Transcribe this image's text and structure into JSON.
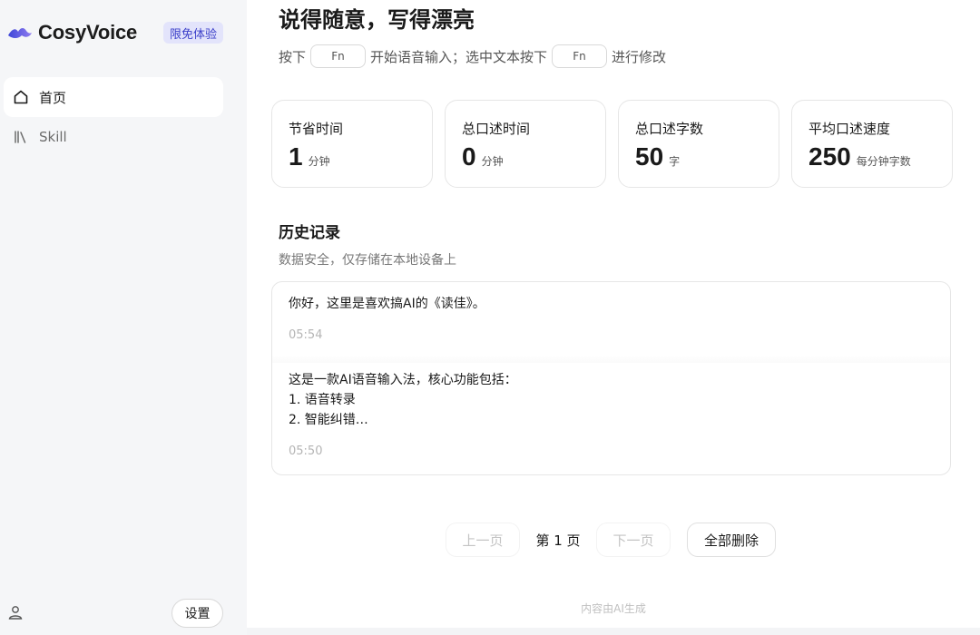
{
  "sidebar": {
    "brand_name": "CosyVoice",
    "brand_badge": "限免体验",
    "items": [
      {
        "label": "首页",
        "icon": "home-icon",
        "active": true
      },
      {
        "label": "Skill",
        "icon": "library-icon",
        "active": false
      }
    ],
    "settings_label": "设置"
  },
  "main": {
    "title": "说得随意，写得漂亮",
    "hint": {
      "prefix": "按下",
      "key1": "Fn",
      "middle": "开始语音输入；选中文本按下",
      "key2": "Fn",
      "suffix": "进行修改"
    },
    "stats": [
      {
        "label": "节省时间",
        "value": "1",
        "unit": "分钟"
      },
      {
        "label": "总口述时间",
        "value": "0",
        "unit": "分钟"
      },
      {
        "label": "总口述字数",
        "value": "50",
        "unit": "字"
      },
      {
        "label": "平均口述速度",
        "value": "250",
        "unit": "每分钟字数"
      }
    ],
    "history": {
      "title": "历史记录",
      "subtitle": "数据安全，仅存储在本地设备上",
      "entries": [
        {
          "text": "你好，这里是喜欢搞AI的《读佳》。",
          "time": "05:54"
        },
        {
          "text": "这是一款AI语音输入法，核心功能包括：\n1. 语音转录\n2. 智能纠错…",
          "time": "05:50"
        }
      ]
    },
    "pagination": {
      "prev": "上一页",
      "current": "第 1 页",
      "next": "下一页",
      "delete_all": "全部删除"
    },
    "footer": "内容由AI生成"
  },
  "colors": {
    "accent": "#4a4fd6",
    "badge_bg": "#e3e4fb",
    "sidebar_bg": "#f5f6f8"
  }
}
